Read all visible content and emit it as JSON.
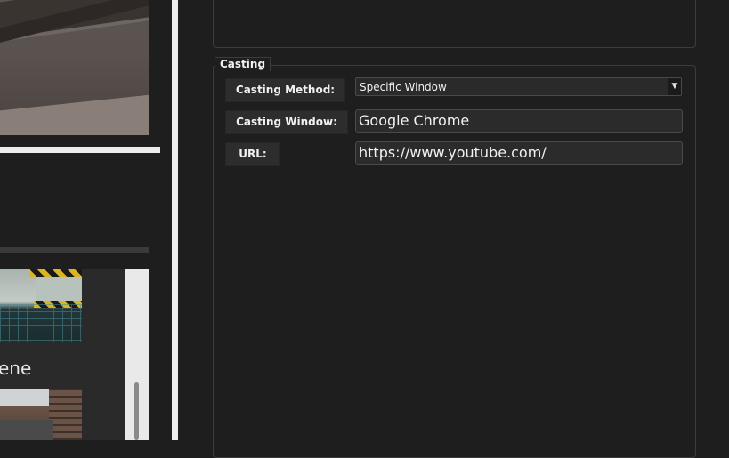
{
  "left_panel": {
    "scene_label": "ene"
  },
  "casting": {
    "group_title": "Casting",
    "method": {
      "label": "Casting Method:",
      "value": "Specific Window"
    },
    "window": {
      "label": "Casting Window:",
      "value": "Google Chrome"
    },
    "url": {
      "label": "URL:",
      "value": "https://www.youtube.com/"
    }
  },
  "icons": {
    "dropdown_arrow": "chevron-down-icon"
  },
  "colors": {
    "background": "#1e1e1e",
    "field_bg": "#2b2b2b",
    "border": "#3c3c3c",
    "splitter": "#ececec"
  }
}
